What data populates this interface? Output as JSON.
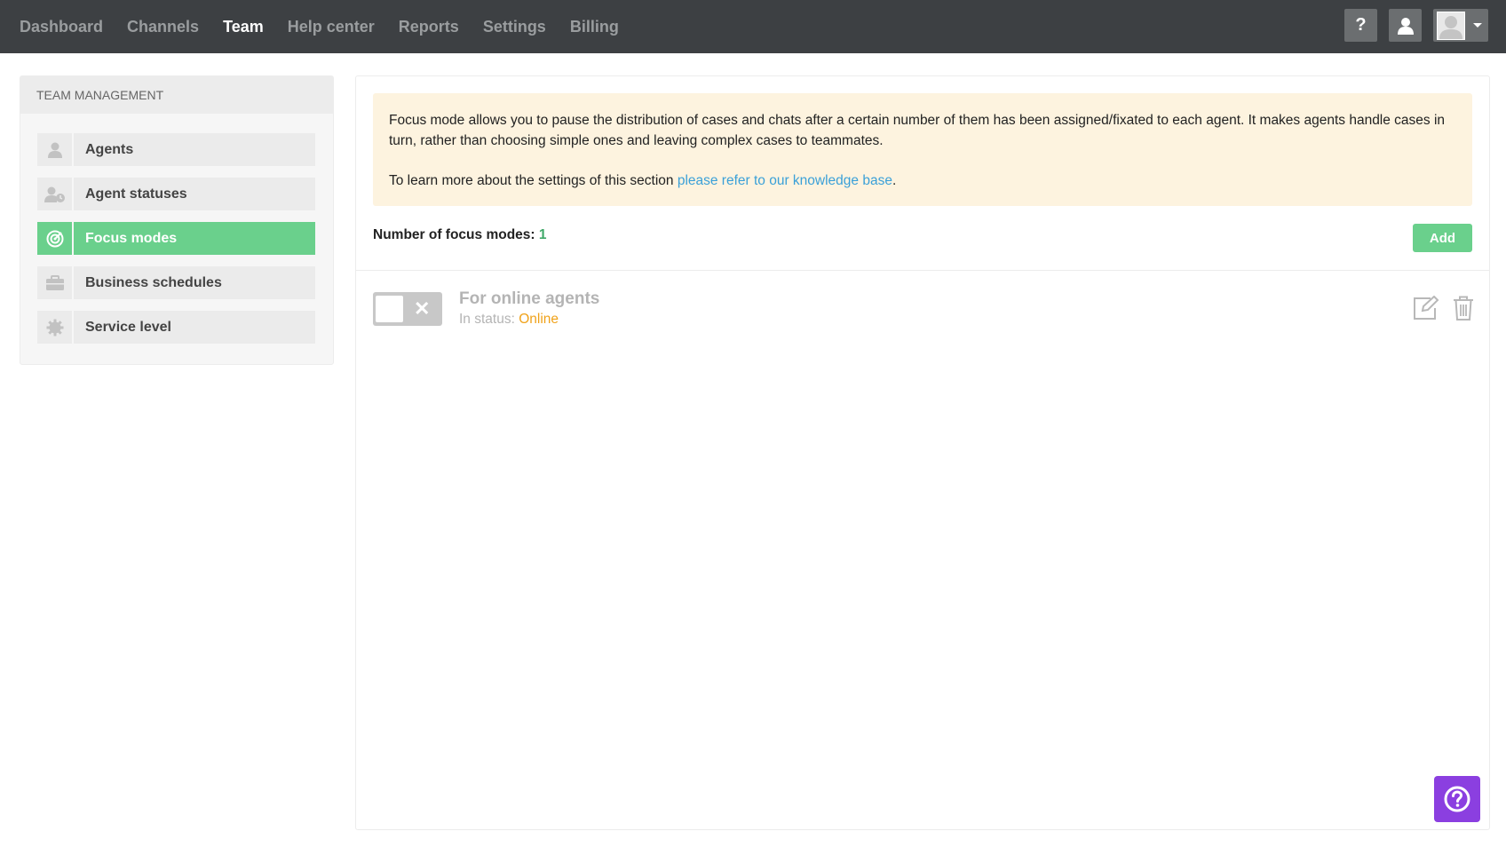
{
  "nav": {
    "items": [
      "Dashboard",
      "Channels",
      "Team",
      "Help center",
      "Reports",
      "Settings",
      "Billing"
    ],
    "active": "Team"
  },
  "topbar": {
    "help_label": "?"
  },
  "sidebar": {
    "header": "TEAM MANAGEMENT",
    "items": [
      {
        "label": "Agents",
        "icon": "user-icon"
      },
      {
        "label": "Agent statuses",
        "icon": "user-clock-icon"
      },
      {
        "label": "Focus modes",
        "icon": "target-icon",
        "active": true
      },
      {
        "label": "Business schedules",
        "icon": "briefcase-icon"
      },
      {
        "label": "Service level",
        "icon": "gear-icon"
      }
    ]
  },
  "notice": {
    "text1": "Focus mode allows you to pause the distribution of cases and chats after a certain number of them has been assigned/fixated to each agent. It makes agents handle cases in turn, rather than choosing simple ones and leaving complex cases to teammates.",
    "text2_prefix": "To learn more about the settings of this section ",
    "link": "please refer to our knowledge base",
    "text2_suffix": "."
  },
  "focus": {
    "count_label": "Number of focus modes:",
    "count": "1",
    "add_label": "Add"
  },
  "modes": [
    {
      "title": "For online agents",
      "status_label": "In status:",
      "status": "Online",
      "enabled": false
    }
  ],
  "colors": {
    "accent": "#6ad08c",
    "topbar": "#3d4043",
    "status_online": "#f0a21a",
    "link": "#3aa0d8",
    "help_float": "#8b3fe0"
  }
}
